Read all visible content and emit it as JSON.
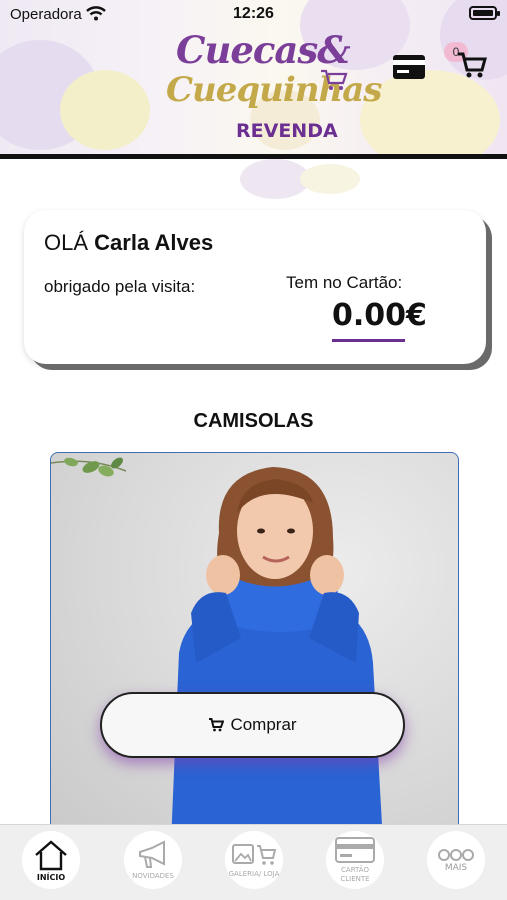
{
  "status_bar": {
    "carrier": "Operadora",
    "time": "12:26"
  },
  "header": {
    "logo_line1": "Cuecas&",
    "logo_line2": "Cuequinhas",
    "logo_line3": "REVENDA",
    "cart_count": "0",
    "icons": [
      "credit-card-icon",
      "cart-icon"
    ]
  },
  "greeting": {
    "prefix": "OLÁ",
    "name": "Carla Alves",
    "thanks": "obrigado pela visita:",
    "card_label": "Tem no Cartão:",
    "card_amount": "0.00€"
  },
  "section": {
    "title": "CAMISOLAS"
  },
  "product": {
    "buy_label": "Comprar"
  },
  "tabbar": {
    "items": [
      {
        "label": "INÍCIO",
        "icon": "home-icon",
        "active": true
      },
      {
        "label": "NOVIDADES",
        "icon": "megaphone-icon",
        "active": false
      },
      {
        "label": "GALERIA/ LOJA",
        "icon": "gallery-cart-icon",
        "active": false
      },
      {
        "label": "CARTÃO CLIENTE",
        "icon": "card-icon",
        "active": false
      },
      {
        "label": "MAIS",
        "icon": "more-icon",
        "active": false
      }
    ]
  },
  "colors": {
    "brand_purple": "#6b2f92",
    "brand_gold": "#c4a94a",
    "sweater_blue": "#2a63d4"
  }
}
